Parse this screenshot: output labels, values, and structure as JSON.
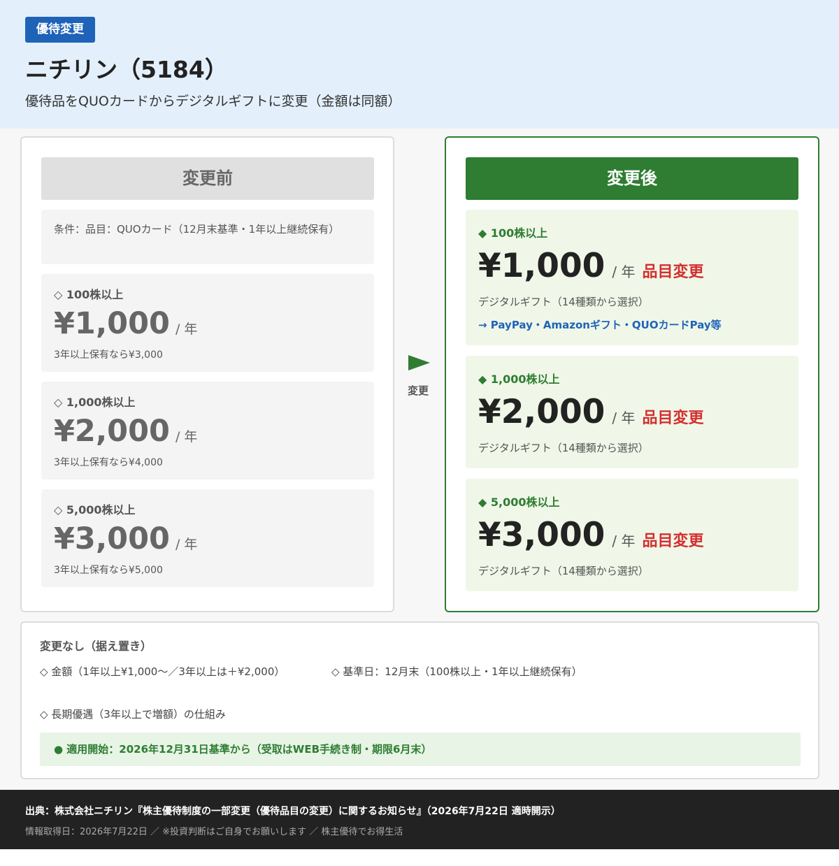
{
  "header": {
    "badge": "優待変更",
    "title": "ニチリン（5184）",
    "subtitle": "優待品をQUOカードからデジタルギフトに変更（金額は同額）"
  },
  "before": {
    "heading": "変更前",
    "condition": "条件：品目：QUOカード（12月末基準・1年以上継続保有）",
    "tiers": [
      {
        "label": "◇ 100株以上",
        "amount": "¥1,000",
        "per": "/ 年",
        "note": "3年以上保有なら¥3,000"
      },
      {
        "label": "◇ 1,000株以上",
        "amount": "¥2,000",
        "per": "/ 年",
        "note": "3年以上保有なら¥4,000"
      },
      {
        "label": "◇ 5,000株以上",
        "amount": "¥3,000",
        "per": "/ 年",
        "note": "3年以上保有なら¥5,000"
      }
    ]
  },
  "arrow": {
    "label": "変更"
  },
  "after": {
    "heading": "変更後",
    "tiers": [
      {
        "label": "◆ 100株以上",
        "amount": "¥1,000",
        "per": "/ 年",
        "change": "品目変更",
        "note": "デジタルギフト（14種類から選択）",
        "link": "→ PayPay・Amazonギフト・QUOカードPay等"
      },
      {
        "label": "◆ 1,000株以上",
        "amount": "¥2,000",
        "per": "/ 年",
        "change": "品目変更",
        "note": "デジタルギフト（14種類から選択）"
      },
      {
        "label": "◆ 5,000株以上",
        "amount": "¥3,000",
        "per": "/ 年",
        "change": "品目変更",
        "note": "デジタルギフト（14種類から選択）"
      }
    ]
  },
  "unchanged": {
    "title": "変更なし（据え置き）",
    "items": [
      "◇ 金額（1年以上¥1,000〜／3年以上は＋¥2,000）",
      "◇ 基準日：12月末（100株以上・1年以上継続保有）",
      "◇ 長期優遇（3年以上で増額）の仕組み"
    ],
    "start": "● 適用開始：2026年12月31日基準から（受取はWEB手続き制・期限6月末）"
  },
  "footer": {
    "source": "出典：株式会社ニチリン『株主優待制度の一部変更（優待品目の変更）に関するお知らせ』（2026年7月22日 適時開示）",
    "info": "情報取得日：2026年7月22日 ／ ※投資判断はご自身でお願いします ／ 株主優待でお得生活"
  },
  "colors": {
    "header_bg": "#e3f0fb",
    "badge": "#1f63b8",
    "accent_green": "#2e7d32",
    "change_red": "#d32f2f",
    "link_blue": "#1f63b8",
    "footer_bg": "#222222"
  }
}
